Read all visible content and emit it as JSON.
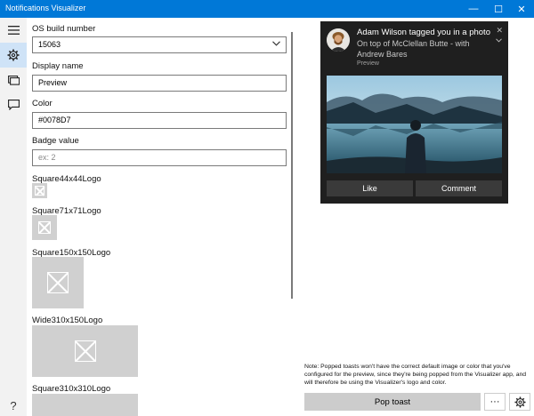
{
  "window": {
    "title": "Notifications Visualizer",
    "minimize_glyph": "—",
    "maximize_glyph": "☐",
    "close_glyph": "✕",
    "accent": "#0078D7"
  },
  "rail": {
    "icons": [
      "hamburger-icon",
      "gear-icon",
      "tiles-icon",
      "chat-icon"
    ],
    "help_glyph": "?"
  },
  "settings": {
    "os_build_label": "OS build number",
    "os_build_value": "15063",
    "display_name_label": "Display name",
    "display_name_value": "Preview",
    "color_label": "Color",
    "color_value": "#0078D7",
    "badge_label": "Badge value",
    "badge_placeholder": "ex: 2",
    "logos": [
      {
        "label": "Square44x44Logo"
      },
      {
        "label": "Square71x71Logo"
      },
      {
        "label": "Square150x150Logo"
      },
      {
        "label": "Wide310x150Logo"
      },
      {
        "label": "Square310x310Logo"
      }
    ]
  },
  "toast": {
    "title": "Adam Wilson tagged you in a photo",
    "body_line1": "On top of McClellan Butte - with",
    "body_line2": "Andrew Bares",
    "attribution": "Preview",
    "close_glyph": "✕",
    "buttons": [
      "Like",
      "Comment"
    ]
  },
  "footer": {
    "note": "Note: Popped toasts won't have the correct default image or color that you've configured for the preview, since they're being popped from the Visualizer app, and will therefore be using the Visualizer's logo and color.",
    "pop_label": "Pop toast",
    "more_label": "···"
  }
}
